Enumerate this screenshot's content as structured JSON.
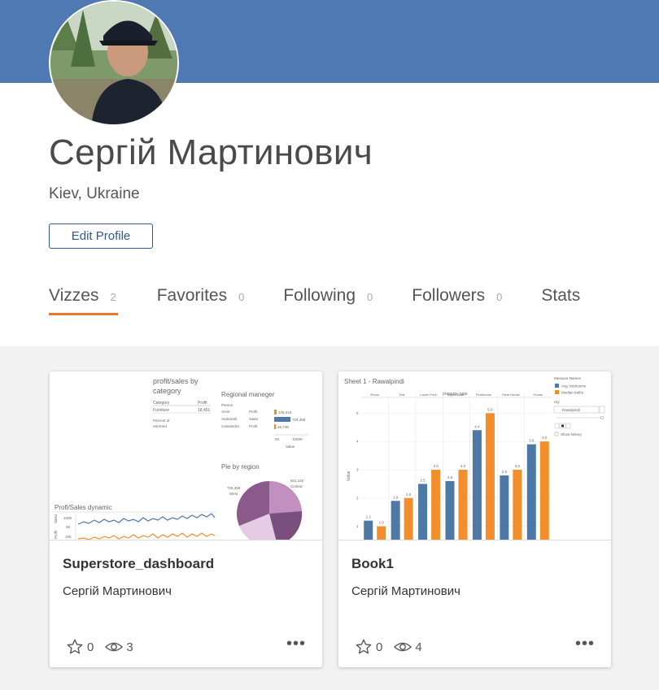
{
  "profile": {
    "name": "Сергій Мартинович",
    "location": "Kiev, Ukraine",
    "edit_label": "Edit Profile"
  },
  "tabs": [
    {
      "label": "Vizzes",
      "count": "2",
      "active": true
    },
    {
      "label": "Favorites",
      "count": "0"
    },
    {
      "label": "Following",
      "count": "0"
    },
    {
      "label": "Followers",
      "count": "0"
    },
    {
      "label": "Stats",
      "count": ""
    }
  ],
  "cards": [
    {
      "title": "Superstore_dashboard",
      "author": "Сергій Мартинович",
      "favorites": "0",
      "views": "3",
      "thumb": {
        "t1": "profit/sales by",
        "t2": "category",
        "h_cat": "Category",
        "h_profit": "Profit",
        "r_cat": "Furniture",
        "r_val": "18,451",
        "pct1": "Percent of",
        "pct2": "returned",
        "reg_title": "Regional maneger",
        "person": "Person",
        "p1": "Anne",
        "p2": "Andreeah",
        "p3": "Cassandra",
        "m1": "Profit",
        "m2": "Sales",
        "m3": "Profit",
        "v1": "108,418",
        "v2": "725,458",
        "v3": "46,749",
        "ax0": "0K",
        "ax1": "1000K",
        "value": "Value",
        "pie_title": "Pie by region",
        "pl1": "501,240",
        "pl1b": "Central",
        "pl2": "725,458",
        "pl2b": "West",
        "dyn_title": "Profi/Sales dynamic",
        "y1": "100K",
        "y2": "0K",
        "y3": "10K",
        "yl1": "Sales",
        "yl2": "Profit"
      }
    },
    {
      "title": "Book1",
      "author": "Сергій Мартинович",
      "favorites": "0",
      "views": "4",
      "thumb": {
        "sheet": "Sheet 1 - Rawalpindi",
        "col_title": "property_type",
        "ylabel": "Value",
        "legend_title": "Measure Names",
        "legend": [
          "Avg. bedrooms",
          "Median baths"
        ],
        "city_label": "city",
        "city_value": "Rawalpindi",
        "show_history": "Show history"
      }
    }
  ],
  "chart_data": {
    "type": "bar",
    "title": "Sheet 1 - Rawalpindi",
    "xlabel": "property_type",
    "ylabel": "Value",
    "categories": [
      "Room",
      "Flat",
      "Lower Porti..",
      "Upper Porti..",
      "Penthouse",
      "Farm House",
      "House"
    ],
    "series": [
      {
        "name": "Avg. bedrooms",
        "color": "#4e79a7",
        "values": [
          1.2,
          1.9,
          2.5,
          2.6,
          4.4,
          2.8,
          3.9
        ]
      },
      {
        "name": "Median baths",
        "color": "#f28e2b",
        "values": [
          1.0,
          2.0,
          3.0,
          3.0,
          5.0,
          3.0,
          4.0
        ]
      }
    ],
    "value_labels": [
      [
        "1.2",
        "1.9",
        "2.5",
        "2.6",
        "4.4",
        "2.8",
        "3.9"
      ],
      [
        "1.0",
        "2.0",
        "3.0",
        "3.0",
        "5.0",
        "3.0",
        "4.0"
      ]
    ],
    "yticks": [
      "1",
      "2",
      "3",
      "4",
      "5"
    ],
    "ylim": [
      0.5,
      5.5
    ],
    "grid": true,
    "legend": "right"
  },
  "colors": {
    "banner": "#4e79b2",
    "accent": "#e8762d",
    "link": "#2e5a94"
  }
}
